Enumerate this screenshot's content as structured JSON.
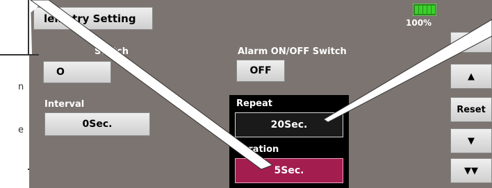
{
  "header": {
    "title": "lemetry Setting",
    "battery_percent": "100%"
  },
  "fields": {
    "switch_label": "Switch",
    "switch_value": "O",
    "alarm_label": "Alarm ON/OFF Switch",
    "alarm_value": "OFF",
    "interval_label": "Interval",
    "interval_value": "0Sec.",
    "repeat_label": "Repeat",
    "repeat_value": "20Sec.",
    "duration_label": "uration",
    "duration_value": "5Sec."
  },
  "side_buttons": {
    "up": "▲",
    "reset": "Reset",
    "down": "▼",
    "page_down": "▼▼"
  },
  "edge_text": {
    "line1": "n",
    "line2": "e"
  },
  "colors": {
    "screen_bg": "#7b7470",
    "duration_bg": "#a31d4f",
    "battery": "#39d12a"
  }
}
